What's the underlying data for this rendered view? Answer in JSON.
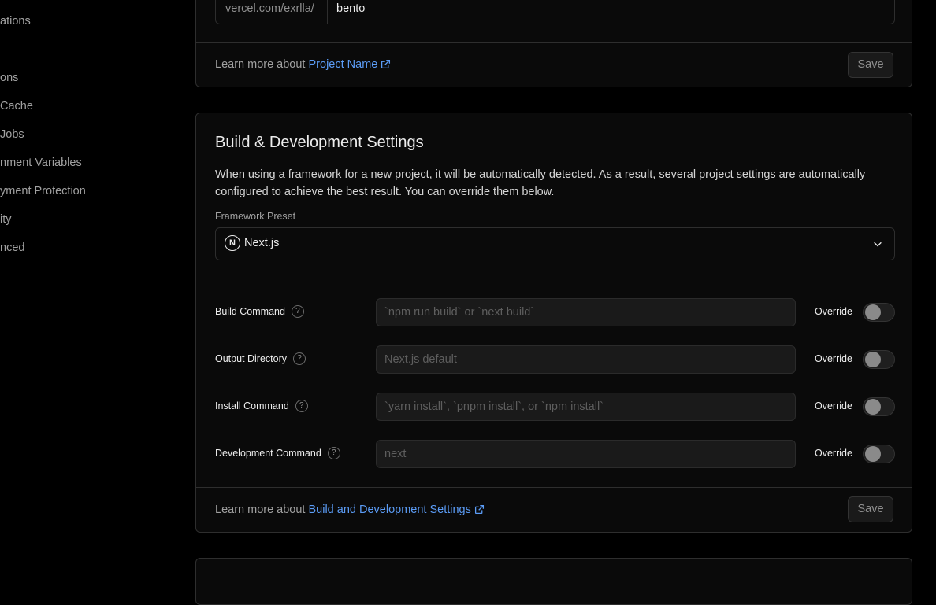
{
  "sidebar": {
    "items": [
      {
        "label": "ations"
      },
      {
        "label": "ons"
      },
      {
        "label": "Cache"
      },
      {
        "label": "Jobs"
      },
      {
        "label": "nment Variables"
      },
      {
        "label": "yment Protection"
      },
      {
        "label": "ity"
      },
      {
        "label": "nced"
      }
    ]
  },
  "project_name_card": {
    "url_prefix": "vercel.com/exrlla/",
    "name_value": "bento",
    "learn_prefix": "Learn more about ",
    "learn_link": "Project Name",
    "save_label": "Save"
  },
  "build_card": {
    "title": "Build & Development Settings",
    "description": "When using a framework for a new project, it will be automatically detected. As a result, several project settings are automatically configured to achieve the best result. You can override them below.",
    "preset_label": "Framework Preset",
    "preset_value": "Next.js",
    "preset_icon": "nextjs-logo-icon",
    "override_label": "Override",
    "rows": [
      {
        "label": "Build Command",
        "placeholder": "`npm run build` or `next build`",
        "override": false
      },
      {
        "label": "Output Directory",
        "placeholder": "Next.js default",
        "override": false
      },
      {
        "label": "Install Command",
        "placeholder": "`yarn install`, `pnpm install`, or `npm install`",
        "override": false
      },
      {
        "label": "Development Command",
        "placeholder": "next",
        "override": false
      }
    ],
    "learn_prefix": "Learn more about ",
    "learn_link": "Build and Development Settings",
    "save_label": "Save"
  },
  "colors": {
    "background": "#000000",
    "card": "#0a0a0a",
    "border": "#2e2e2e",
    "link": "#5b9cf6",
    "text": "#ededed",
    "muted": "#a1a1a1"
  }
}
